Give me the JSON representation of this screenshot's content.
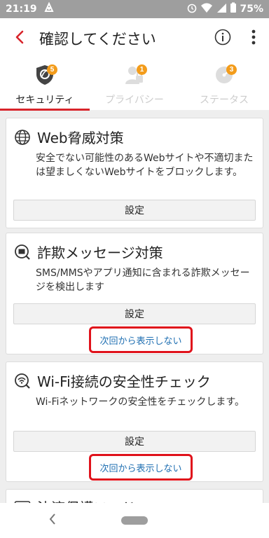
{
  "status_bar": {
    "time": "21:19",
    "battery": "75%"
  },
  "header": {
    "title": "確認してください"
  },
  "tabs": [
    {
      "label": "セキュリティ",
      "badge": "5"
    },
    {
      "label": "プライバシー",
      "badge": "1"
    },
    {
      "label": "ステータス",
      "badge": "3"
    }
  ],
  "cards": [
    {
      "title": "Web脅威対策",
      "description": "安全でない可能性のあるWebサイトや不適切または望ましくないWebサイトをブロックします。",
      "button_label": "設定"
    },
    {
      "title": "詐欺メッセージ対策",
      "description": "SMS/MMSやアプリ通知に含まれる詐欺メッセージを検出します",
      "button_label": "設定",
      "dismiss_label": "次回から表示しない"
    },
    {
      "title": "Wi-Fi接続の安全性チェック",
      "description": "Wi-Fiネットワークの安全性をチェックします。",
      "button_label": "設定",
      "dismiss_label": "次回から表示しない"
    },
    {
      "title": "決済保護モード"
    }
  ],
  "colors": {
    "accent": "#d8242b",
    "badge": "#f39c1b",
    "link": "#1f6fb2",
    "highlight": "#e0121b"
  }
}
